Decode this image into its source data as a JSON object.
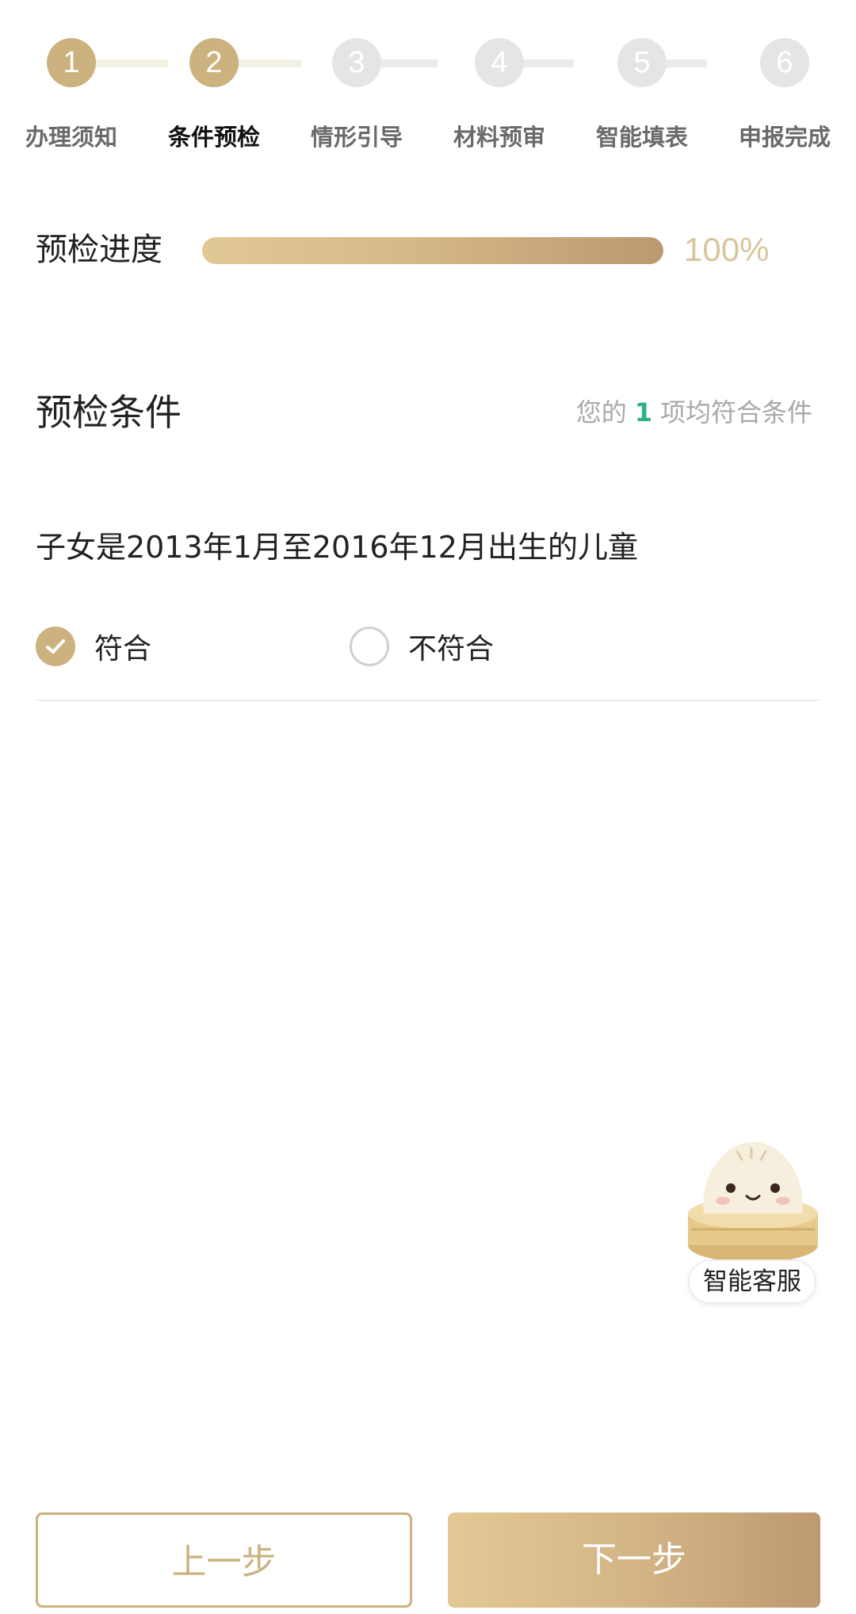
{
  "stepper": {
    "steps": [
      {
        "number": "1",
        "label": "办理须知",
        "state": "done"
      },
      {
        "number": "2",
        "label": "条件预检",
        "state": "current"
      },
      {
        "number": "3",
        "label": "情形引导",
        "state": "pending"
      },
      {
        "number": "4",
        "label": "材料预审",
        "state": "pending"
      },
      {
        "number": "5",
        "label": "智能填表",
        "state": "pending"
      },
      {
        "number": "6",
        "label": "申报完成",
        "state": "pending"
      }
    ]
  },
  "progress": {
    "label": "预检进度",
    "value_text": "100%",
    "fraction": 1.0
  },
  "conditions": {
    "title": "预检条件",
    "summary_prefix": "您的",
    "count": "1",
    "summary_suffix": "项均符合条件"
  },
  "question": {
    "text": "子女是2013年1月至2016年12月出生的儿童",
    "options": [
      {
        "label": "符合",
        "selected": true
      },
      {
        "label": "不符合",
        "selected": false
      }
    ]
  },
  "assistant": {
    "label": "智能客服",
    "icon": "steamed-bun-mascot-icon"
  },
  "buttons": {
    "prev_label": "上一步",
    "next_label": "下一步"
  },
  "colors": {
    "accent": "#cbb27f",
    "progress_start": "#e1c995",
    "progress_end": "#bc9970",
    "highlight_count": "#2fb089",
    "muted_text": "#a9a9a9"
  }
}
